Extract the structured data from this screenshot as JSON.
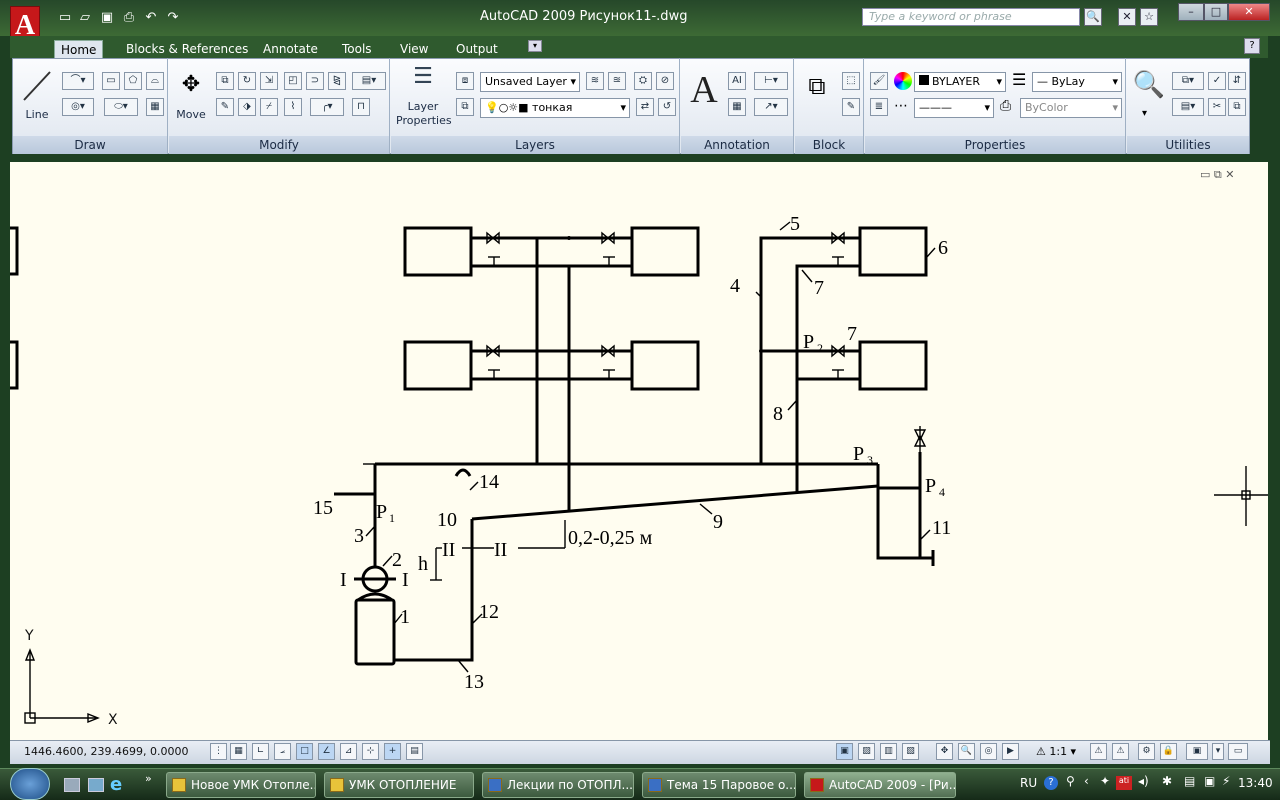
{
  "window": {
    "title": "AutoCAD 2009 Рисунок11-.dwg",
    "search_placeholder": "Type a keyword or phrase",
    "app_logo": "A"
  },
  "tabs": [
    {
      "label": "Home"
    },
    {
      "label": "Blocks & References"
    },
    {
      "label": "Annotate"
    },
    {
      "label": "Tools"
    },
    {
      "label": "View"
    },
    {
      "label": "Output"
    }
  ],
  "panels": {
    "draw": "Draw",
    "modify": "Modify",
    "layers": "Layers",
    "annotation": "Annotation",
    "block": "Block",
    "properties": "Properties",
    "utilities": "Utilities"
  },
  "tools": {
    "line": "Line",
    "move": "Move",
    "layer_properties": "Layer Properties",
    "layer_properties_2": "Properties"
  },
  "layers": {
    "current": "Unsaved Layer",
    "layer_state": "тонкая"
  },
  "properties": {
    "color": "BYLAYER",
    "linetype": "ByLay",
    "lineweight": "",
    "plotstyle": "ByColor"
  },
  "drawing_labels": {
    "n1": "1",
    "n2": "2",
    "n3": "3",
    "n4": "4",
    "n5": "5",
    "n6": "6",
    "n7a": "7",
    "n7b": "7",
    "n8": "8",
    "n9": "9",
    "n10": "10",
    "n11": "11",
    "n12": "12",
    "n13": "13",
    "n14": "14",
    "n15": "15",
    "p1": "P",
    "p1s": "1",
    "p2": "P",
    "p2s": "2",
    "p3": "P",
    "p3s": "3",
    "p4": "P",
    "p4s": "4",
    "secI_l": "I",
    "secI_r": "I",
    "secII_l": "II",
    "secII_r": "II",
    "h": "h",
    "dim": "0,2-0,25 м"
  },
  "ucs": {
    "x": "X",
    "y": "Y"
  },
  "status": {
    "coords": "1446.4600, 239.4699, 0.0000",
    "scale": "1:1"
  },
  "taskbar": {
    "items": [
      {
        "label": "Новое УМК Отопле..."
      },
      {
        "label": "УМК ОТОПЛЕНИЕ"
      },
      {
        "label": "Лекции по ОТОПЛ..."
      },
      {
        "label": "Тема 15 Паровое о..."
      },
      {
        "label": "AutoCAD 2009 - [Ри..."
      }
    ],
    "lang": "RU",
    "clock": "13:40"
  }
}
